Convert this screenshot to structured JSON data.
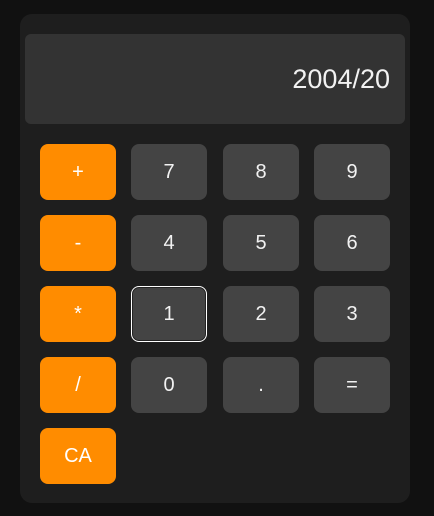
{
  "display": {
    "value": "2004/20"
  },
  "keys": {
    "plus": "+",
    "minus": "-",
    "multiply": "*",
    "divide": "/",
    "clear": "CA",
    "seven": "7",
    "eight": "8",
    "nine": "9",
    "four": "4",
    "five": "5",
    "six": "6",
    "one": "1",
    "two": "2",
    "three": "3",
    "zero": "0",
    "decimal": ".",
    "equals": "="
  },
  "colors": {
    "operator": "#ff8c00",
    "digit": "#444444",
    "panel": "#1e1e1e",
    "display": "#333333"
  }
}
